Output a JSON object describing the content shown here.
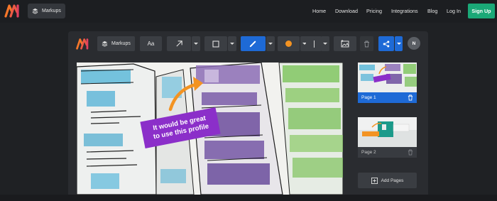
{
  "brand": {
    "logo_icon": "markup-m-logo-icon",
    "colors": {
      "logo_orange": "#f7772a",
      "logo_pink": "#e4415f",
      "accent_blue": "#1e6ad6",
      "signup_green": "#1aa877",
      "callout_purple": "#8b2fc9",
      "annotation_orange": "#f39322"
    }
  },
  "topbar": {
    "workspace_label": "Markups",
    "nav": [
      "Home",
      "Download",
      "Pricing",
      "Integrations",
      "Blog",
      "Log In"
    ],
    "signup_label": "Sign Up"
  },
  "toolbar": {
    "workspace_label": "Markups",
    "text_tool_label": "Aa",
    "tools": [
      "layers-icon",
      "text-icon",
      "arrow-icon",
      "rectangle-icon",
      "pen-icon",
      "color-dot-icon",
      "line-width-icon",
      "image-icon",
      "trash-icon",
      "share-icon"
    ],
    "avatar_initial": "N"
  },
  "canvas": {
    "callout_line1": "It would be great",
    "callout_line2": "to use this profile"
  },
  "pages": {
    "items": [
      {
        "label": "Page 1",
        "selected": true
      },
      {
        "label": "Page 2",
        "selected": false
      }
    ],
    "add_label": "Add Pages"
  }
}
